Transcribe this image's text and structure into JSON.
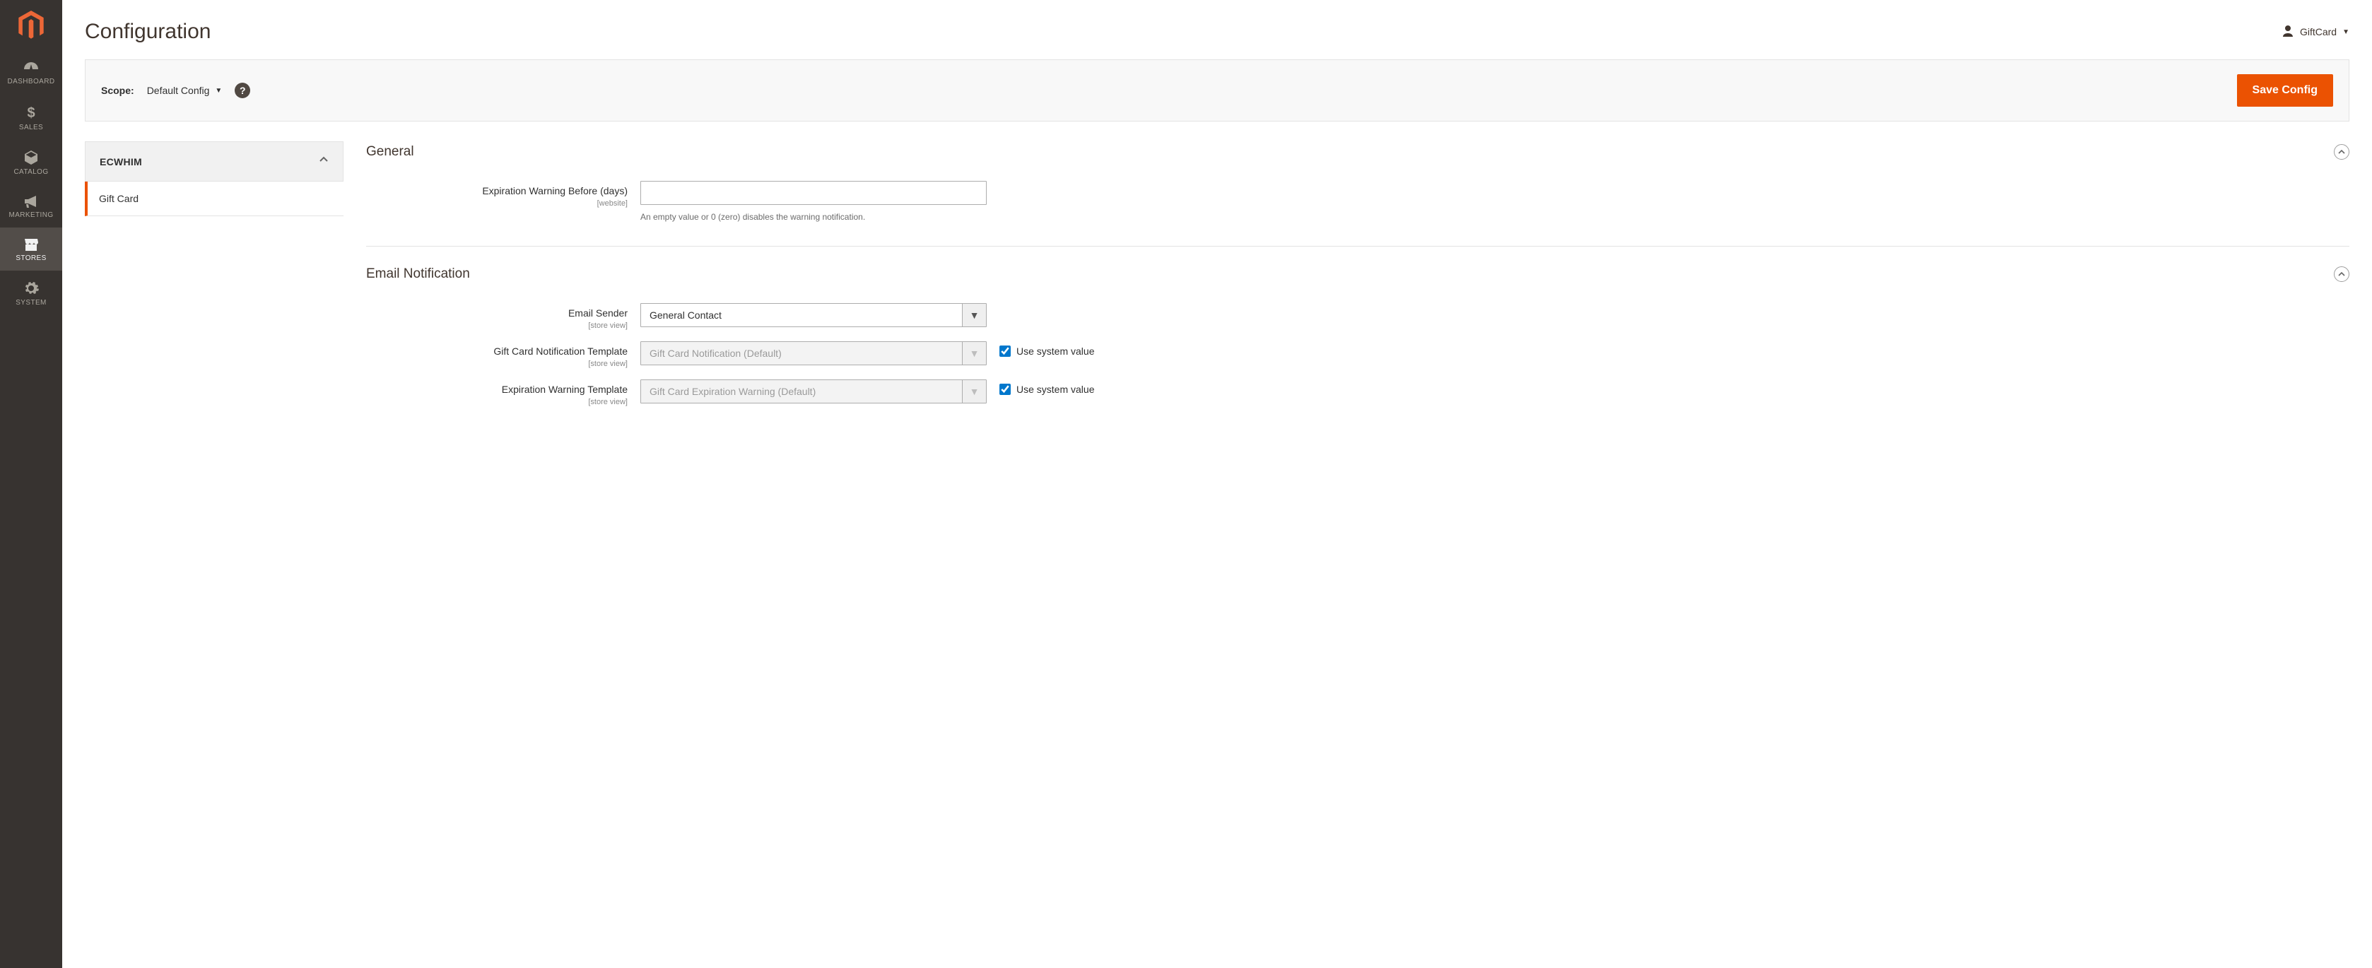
{
  "sidebar": {
    "items": [
      {
        "id": "dashboard",
        "label": "DASHBOARD"
      },
      {
        "id": "sales",
        "label": "SALES"
      },
      {
        "id": "catalog",
        "label": "CATALOG"
      },
      {
        "id": "marketing",
        "label": "MARKETING"
      },
      {
        "id": "stores",
        "label": "STORES"
      },
      {
        "id": "system",
        "label": "SYSTEM"
      }
    ]
  },
  "page": {
    "title": "Configuration"
  },
  "account": {
    "name": "GiftCard"
  },
  "toolbar": {
    "scope_label": "Scope:",
    "scope_value": "Default Config",
    "save_label": "Save Config"
  },
  "tabs": {
    "group_title": "ECWHIM",
    "items": [
      {
        "label": "Gift Card"
      }
    ]
  },
  "sections": {
    "general": {
      "title": "General",
      "fields": {
        "expiration_warning_before": {
          "label": "Expiration Warning Before (days)",
          "scope": "[website]",
          "value": "",
          "note": "An empty value or 0 (zero) disables the warning notification."
        }
      }
    },
    "email": {
      "title": "Email Notification",
      "fields": {
        "email_sender": {
          "label": "Email Sender",
          "scope": "[store view]",
          "value": "General Contact"
        },
        "gc_notification_tpl": {
          "label": "Gift Card Notification Template",
          "scope": "[store view]",
          "value": "Gift Card Notification (Default)",
          "use_system_label": "Use system value",
          "use_system_checked": true
        },
        "exp_warning_tpl": {
          "label": "Expiration Warning Template",
          "scope": "[store view]",
          "value": "Gift Card Expiration Warning (Default)",
          "use_system_label": "Use system value",
          "use_system_checked": true
        }
      }
    }
  }
}
